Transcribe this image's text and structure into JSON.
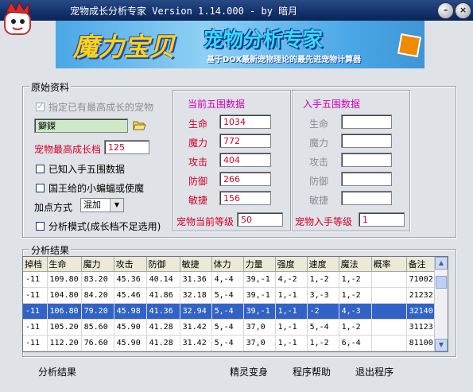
{
  "window": {
    "title": "宠物成长分析专家 Version 1.14.000 - by 暗月",
    "buttons": [
      "minimize",
      "close"
    ]
  },
  "banner": {
    "logo": "魔力宝贝",
    "title": "宠物分析专家",
    "subtitle": "基于DOX最新宠物理论的最先进宠物计算器"
  },
  "raw": {
    "group_label": "原始资料",
    "checkbox_specified_label": "指定已有最高成长的宠物",
    "pet_name": "鐴鏫",
    "max_growth_label": "宠物最高成长档",
    "max_growth_value": "125",
    "known_stats_label": "已知入手五围数据",
    "king_bat_label": "国王给的小蝙蝠或使魔",
    "add_point_label": "加点方式",
    "add_point_value": "混加",
    "analysis_mode_label": "分析模式(成长档不足选用)"
  },
  "current": {
    "header": "当前五围数据",
    "stats": [
      {
        "label": "生命",
        "value": "1034"
      },
      {
        "label": "魔力",
        "value": "772"
      },
      {
        "label": "攻击",
        "value": "404"
      },
      {
        "label": "防御",
        "value": "266"
      },
      {
        "label": "敏捷",
        "value": "156"
      }
    ],
    "level_label": "宠物当前等级",
    "level_value": "50"
  },
  "initial": {
    "header": "入手五围数据",
    "stats": [
      {
        "label": "生命",
        "value": ""
      },
      {
        "label": "魔力",
        "value": ""
      },
      {
        "label": "攻击",
        "value": ""
      },
      {
        "label": "防御",
        "value": ""
      },
      {
        "label": "敏捷",
        "value": ""
      }
    ],
    "level_label": "宠物入手等级",
    "level_value": "1"
  },
  "results": {
    "group_label": "分析结果",
    "columns": [
      "掉档",
      "生命",
      "魔力",
      "攻击",
      "防御",
      "敏捷",
      "体力",
      "力量",
      "强度",
      "速度",
      "魔法",
      "概率",
      "备注"
    ],
    "rows": [
      [
        "-11",
        "109.80",
        "83.20",
        "45.36",
        "40.14",
        "31.36",
        "4,-4",
        "39,-1",
        "4,-2",
        "1,-2",
        "1,-2",
        "",
        "71002"
      ],
      [
        "-11",
        "104.80",
        "84.20",
        "45.46",
        "41.86",
        "32.18",
        "5,-4",
        "39,-1",
        "1,-1",
        "3,-3",
        "1,-2",
        "",
        "21232"
      ],
      [
        "-11",
        "106.80",
        "79.20",
        "45.98",
        "41.36",
        "32.94",
        "5,-4",
        "39,-1",
        "1,-1",
        "-2",
        "4,-3",
        "",
        "32140"
      ],
      [
        "-11",
        "105.20",
        "85.60",
        "45.90",
        "41.28",
        "31.42",
        "5,-4",
        "37,0",
        "1,-1",
        "5,-4",
        "1,-2",
        "",
        "31123"
      ],
      [
        "-11",
        "112.20",
        "76.60",
        "45.90",
        "41.28",
        "31.42",
        "5,-4",
        "37,0",
        "1,-1",
        "1,-2",
        "6,-4",
        "",
        "81100"
      ]
    ],
    "selected_row": 2
  },
  "bottom": {
    "analyze": "分析结果",
    "transform": "精灵变身",
    "help": "程序帮助",
    "exit": "退出程序"
  },
  "colors": {
    "title_bar": "#13336e",
    "header_accent": "#d400b8",
    "stat_label": "#d4002a",
    "selection": "#3163c6"
  }
}
